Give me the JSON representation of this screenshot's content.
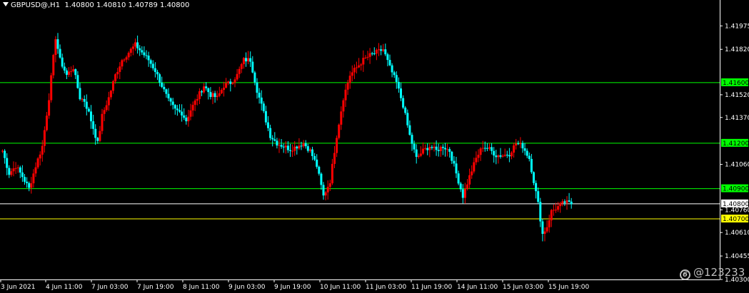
{
  "header": {
    "symbol": "GBPUSD@,H1",
    "ohlc": "1.40800 1.40810 1.40789 1.40800"
  },
  "watermark": {
    "text": "@123233",
    "logo": "6"
  },
  "chart_data": {
    "type": "candlestick",
    "symbol": "GBPUSD@",
    "timeframe": "H1",
    "colors": {
      "background": "#000000",
      "bull": "#ff0000",
      "bear": "#00ffff",
      "level_line": "#00ff00",
      "current_line": "#ffffff",
      "level_yellow": "#ffff00"
    },
    "ylim": [
      1.403,
      1.4208
    ],
    "y_ticks": [
      "1.41975",
      "1.41820",
      "1.41520",
      "1.41370",
      "1.41060",
      "1.40760",
      "1.40610",
      "1.40455",
      "1.40300"
    ],
    "x_ticks": [
      "3 Jun 2021",
      "4 Jun 11:00",
      "7 Jun 03:00",
      "7 Jun 19:00",
      "8 Jun 11:00",
      "9 Jun 03:00",
      "9 Jun 19:00",
      "10 Jun 11:00",
      "11 Jun 03:00",
      "11 Jun 19:00",
      "14 Jun 11:00",
      "15 Jun 03:00",
      "15 Jun 19:00"
    ],
    "levels": [
      {
        "value": 1.416,
        "label": "1.41600",
        "color": "#00ff00"
      },
      {
        "value": 1.412,
        "label": "1.41200",
        "color": "#00ff00"
      },
      {
        "value": 1.409,
        "label": "1.40900",
        "color": "#00ff00"
      },
      {
        "value": 1.408,
        "label": "1.40800",
        "color": "#ffffff"
      },
      {
        "value": 1.407,
        "label": "1.40700",
        "color": "#ffff00"
      }
    ],
    "waypoints": [
      [
        0,
        1.4115
      ],
      [
        3,
        1.41
      ],
      [
        6,
        1.4105
      ],
      [
        9,
        1.4098
      ],
      [
        12,
        1.409
      ],
      [
        15,
        1.4105
      ],
      [
        18,
        1.4118
      ],
      [
        21,
        1.415
      ],
      [
        24,
        1.419
      ],
      [
        26,
        1.4175
      ],
      [
        29,
        1.4165
      ],
      [
        32,
        1.417
      ],
      [
        35,
        1.415
      ],
      [
        37,
        1.4148
      ],
      [
        39,
        1.414
      ],
      [
        41,
        1.413
      ],
      [
        43,
        1.412
      ],
      [
        45,
        1.4138
      ],
      [
        48,
        1.415
      ],
      [
        51,
        1.4165
      ],
      [
        54,
        1.4175
      ],
      [
        57,
        1.418
      ],
      [
        60,
        1.4185
      ],
      [
        63,
        1.418
      ],
      [
        66,
        1.4175
      ],
      [
        69,
        1.4168
      ],
      [
        72,
        1.4158
      ],
      [
        75,
        1.4148
      ],
      [
        78,
        1.4142
      ],
      [
        81,
        1.414
      ],
      [
        83,
        1.4135
      ],
      [
        85,
        1.4142
      ],
      [
        88,
        1.415
      ],
      [
        91,
        1.4158
      ],
      [
        94,
        1.4152
      ],
      [
        97,
        1.415
      ],
      [
        100,
        1.4158
      ],
      [
        103,
        1.416
      ],
      [
        106,
        1.4165
      ],
      [
        109,
        1.4175
      ],
      [
        112,
        1.4175
      ],
      [
        115,
        1.4155
      ],
      [
        118,
        1.414
      ],
      [
        121,
        1.4125
      ],
      [
        124,
        1.412
      ],
      [
        127,
        1.4118
      ],
      [
        130,
        1.4116
      ],
      [
        133,
        1.4118
      ],
      [
        136,
        1.412
      ],
      [
        139,
        1.4115
      ],
      [
        142,
        1.4105
      ],
      [
        145,
        1.4085
      ],
      [
        148,
        1.4095
      ],
      [
        151,
        1.4125
      ],
      [
        154,
        1.415
      ],
      [
        157,
        1.4165
      ],
      [
        160,
        1.417
      ],
      [
        163,
        1.4175
      ],
      [
        166,
        1.4178
      ],
      [
        169,
        1.418
      ],
      [
        172,
        1.4182
      ],
      [
        175,
        1.417
      ],
      [
        178,
        1.416
      ],
      [
        181,
        1.4145
      ],
      [
        184,
        1.4125
      ],
      [
        187,
        1.411
      ],
      [
        190,
        1.4115
      ],
      [
        193,
        1.4118
      ],
      [
        196,
        1.4115
      ],
      [
        199,
        1.4118
      ],
      [
        202,
        1.4115
      ],
      [
        205,
        1.41
      ],
      [
        208,
        1.4085
      ],
      [
        211,
        1.4098
      ],
      [
        214,
        1.411
      ],
      [
        217,
        1.4118
      ],
      [
        220,
        1.4116
      ],
      [
        223,
        1.4112
      ],
      [
        226,
        1.4112
      ],
      [
        229,
        1.4113
      ],
      [
        232,
        1.412
      ],
      [
        235,
        1.4118
      ],
      [
        238,
        1.411
      ],
      [
        240,
        1.4095
      ],
      [
        242,
        1.408
      ],
      [
        244,
        1.406
      ],
      [
        246,
        1.4065
      ],
      [
        248,
        1.4075
      ],
      [
        251,
        1.4078
      ],
      [
        254,
        1.4081
      ],
      [
        257,
        1.408
      ]
    ]
  }
}
